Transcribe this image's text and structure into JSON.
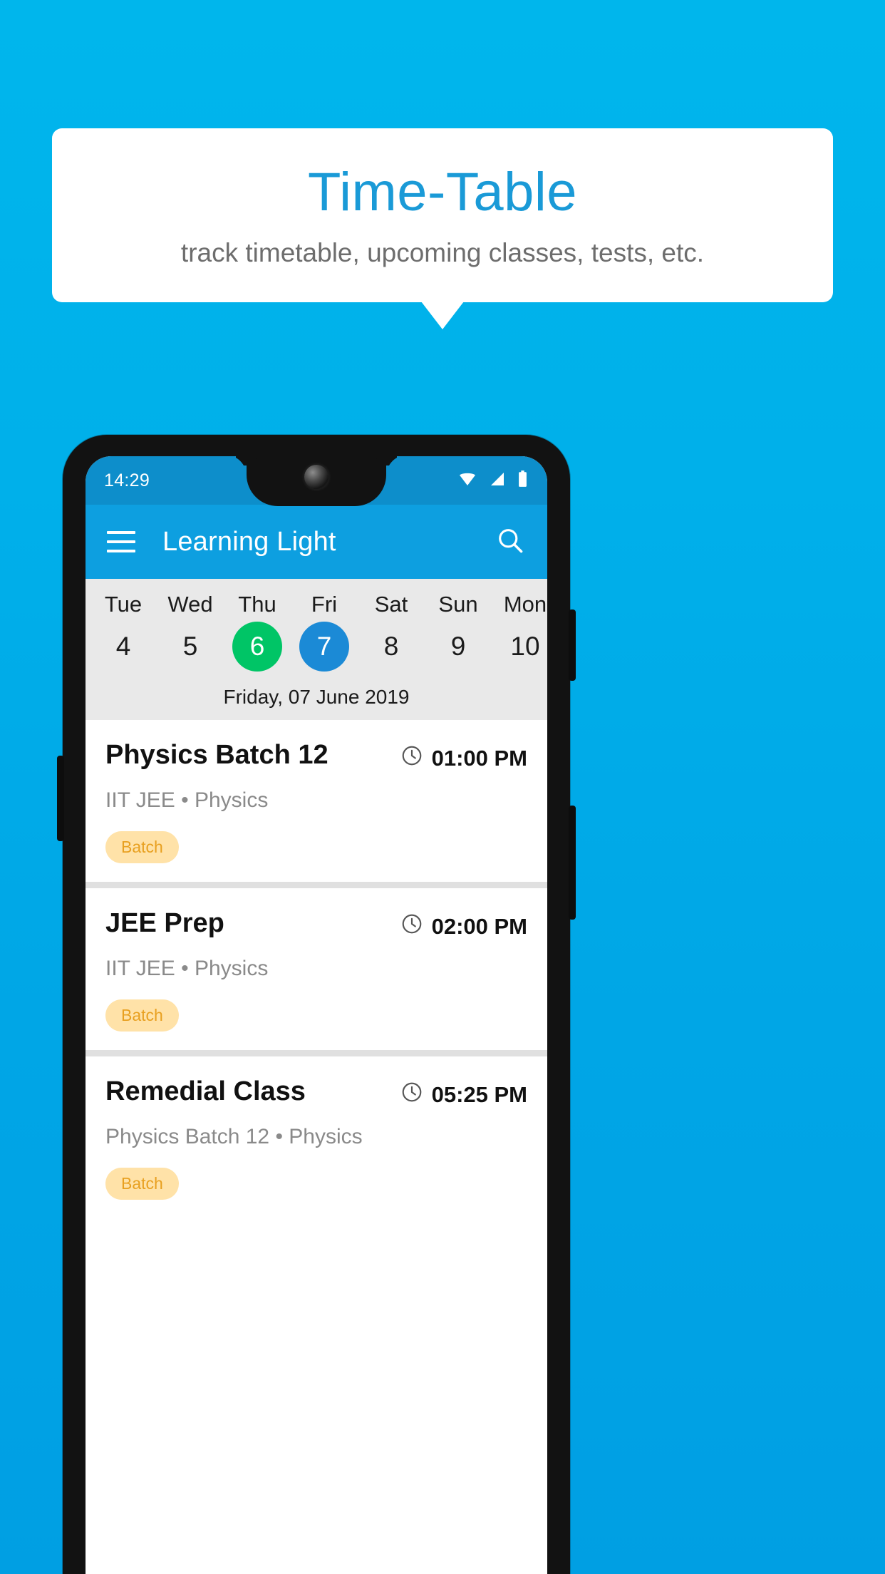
{
  "promo": {
    "title": "Time-Table",
    "subtitle": "track timetable, upcoming classes, tests, etc.",
    "accent_color": "#1a9ad7",
    "background_color": "#00ace4"
  },
  "phone": {
    "statusbar": {
      "time": "14:29",
      "icons": [
        "wifi-icon",
        "signal-icon",
        "battery-icon"
      ]
    },
    "appbar": {
      "menu_icon": "hamburger-menu-icon",
      "title": "Learning Light",
      "search_icon": "search-icon",
      "color": "#0d9fe0"
    },
    "calendar": {
      "days": [
        {
          "day": "Tue",
          "date": "4",
          "state": "normal"
        },
        {
          "day": "Wed",
          "date": "5",
          "state": "normal"
        },
        {
          "day": "Thu",
          "date": "6",
          "state": "today"
        },
        {
          "day": "Fri",
          "date": "7",
          "state": "selected"
        },
        {
          "day": "Sat",
          "date": "8",
          "state": "normal"
        },
        {
          "day": "Sun",
          "date": "9",
          "state": "normal"
        },
        {
          "day": "Mon",
          "date": "10",
          "state": "normal"
        }
      ],
      "selected_date_label": "Friday, 07 June 2019",
      "today_color": "#00c566",
      "selected_color": "#1b8ad6"
    },
    "classes": [
      {
        "title": "Physics Batch 12",
        "time": "01:00 PM",
        "subtitle": "IIT JEE • Physics",
        "badge": "Batch"
      },
      {
        "title": "JEE Prep",
        "time": "02:00 PM",
        "subtitle": "IIT JEE • Physics",
        "badge": "Batch"
      },
      {
        "title": "Remedial Class",
        "time": "05:25 PM",
        "subtitle": "Physics Batch 12 • Physics",
        "badge": "Batch"
      }
    ]
  }
}
